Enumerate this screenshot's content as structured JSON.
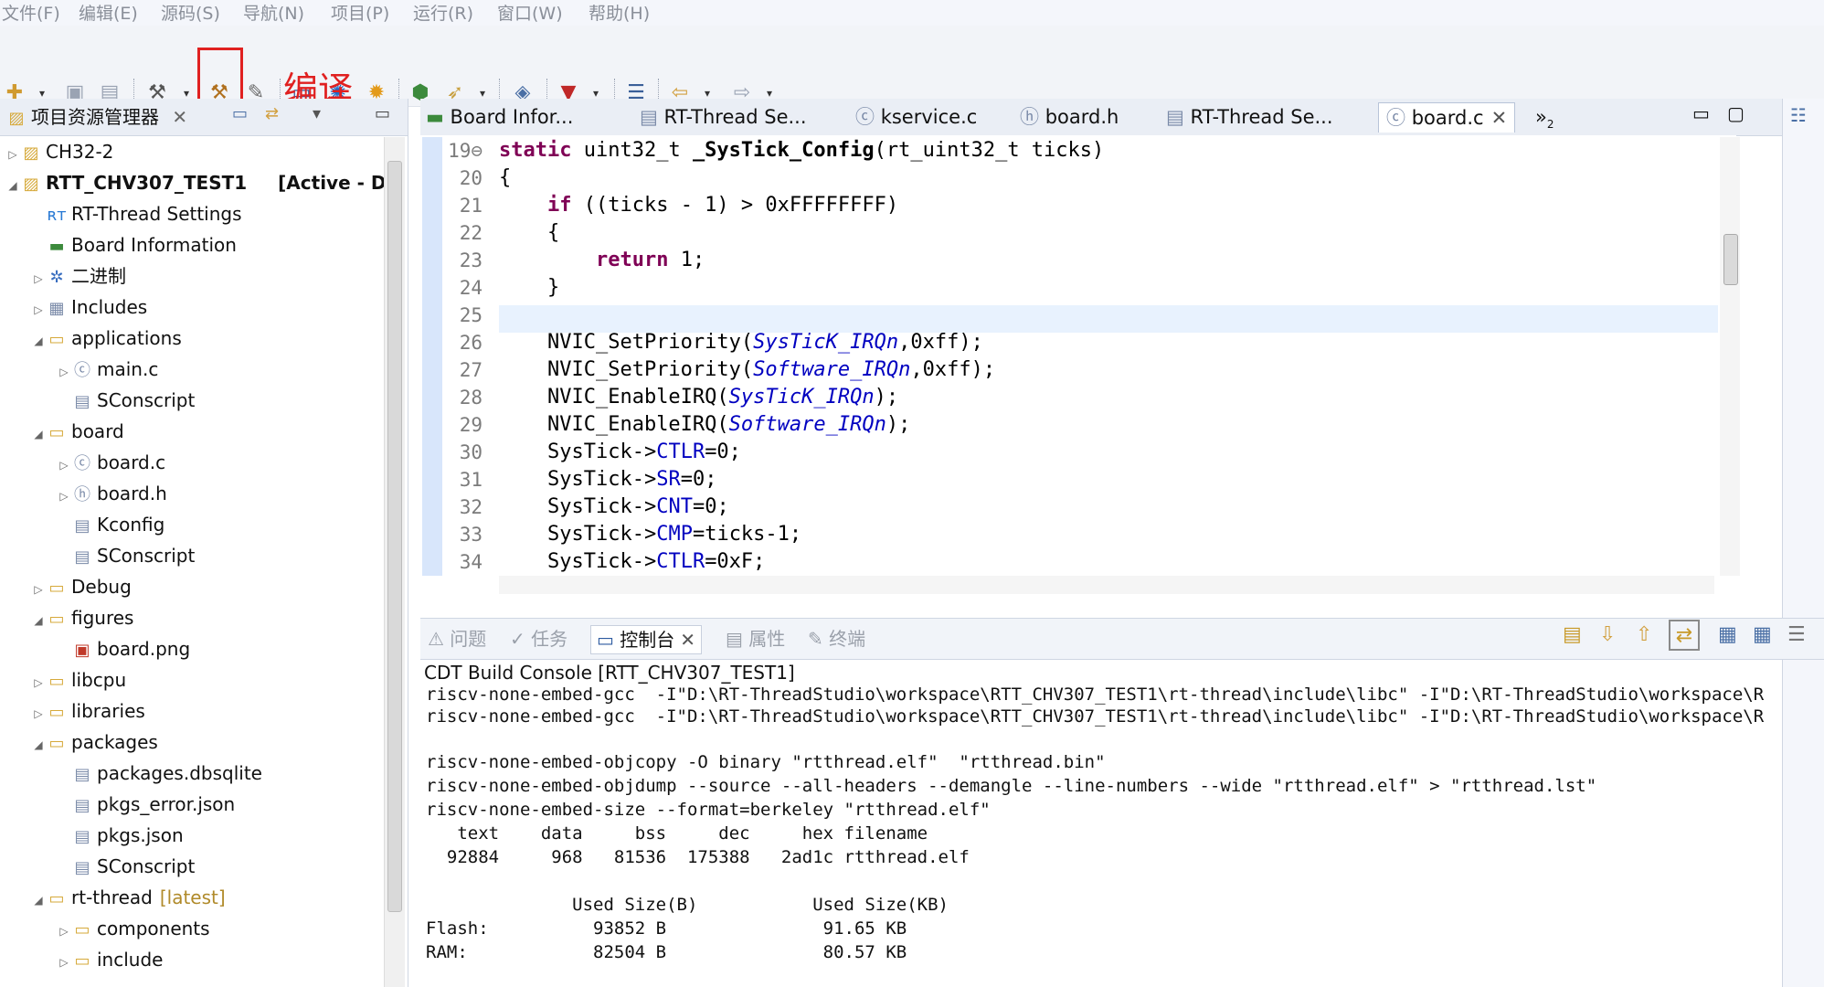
{
  "menu": [
    "文件(F)",
    "编辑(E)",
    "源码(S)",
    "导航(N)",
    "项目(P)",
    "运行(R)",
    "窗口(W)",
    "帮助(H)"
  ],
  "annotation": "编译",
  "explorer": {
    "title": "项目资源管理器",
    "items": [
      {
        "label": "CH32-2"
      },
      {
        "label": "RTT_CHV307_TEST1",
        "suffix": "[Active - De"
      },
      {
        "label": "RT-Thread Settings"
      },
      {
        "label": "Board Information"
      },
      {
        "label": "二进制"
      },
      {
        "label": "Includes"
      },
      {
        "label": "applications"
      },
      {
        "label": "main.c"
      },
      {
        "label": "SConscript"
      },
      {
        "label": "board"
      },
      {
        "label": "board.c"
      },
      {
        "label": "board.h"
      },
      {
        "label": "Kconfig"
      },
      {
        "label": "SConscript"
      },
      {
        "label": "Debug"
      },
      {
        "label": "figures"
      },
      {
        "label": "board.png"
      },
      {
        "label": "libcpu"
      },
      {
        "label": "libraries"
      },
      {
        "label": "packages"
      },
      {
        "label": "packages.dbsqlite"
      },
      {
        "label": "pkgs_error.json"
      },
      {
        "label": "pkgs.json"
      },
      {
        "label": "SConscript"
      },
      {
        "label": "rt-thread",
        "suffix": "[latest]"
      },
      {
        "label": "components"
      },
      {
        "label": "include"
      }
    ]
  },
  "editor": {
    "tabs": [
      "Board Infor...",
      "RT-Thread Se...",
      "kservice.c",
      "board.h",
      "RT-Thread Se...",
      "board.c"
    ],
    "overflow": "»",
    "overflow_count": "2",
    "lines": [
      {
        "n": "19⊖",
        "t": ""
      },
      {
        "n": "20",
        "t": "{"
      },
      {
        "n": "21",
        "t": ""
      },
      {
        "n": "22",
        "t": "    {"
      },
      {
        "n": "23",
        "t": ""
      },
      {
        "n": "24",
        "t": "    }"
      },
      {
        "n": "25",
        "t": ""
      },
      {
        "n": "26",
        "t": ""
      },
      {
        "n": "27",
        "t": ""
      },
      {
        "n": "28",
        "t": ""
      },
      {
        "n": "29",
        "t": ""
      },
      {
        "n": "30",
        "t": ""
      },
      {
        "n": "31",
        "t": ""
      },
      {
        "n": "32",
        "t": ""
      },
      {
        "n": "33",
        "t": ""
      },
      {
        "n": "34",
        "t": ""
      }
    ],
    "code": {
      "l19_kw": "static",
      "l19_rest": " uint32_t ",
      "l19_fn": "_SysTick_Config",
      "l19_args": "(rt_uint32_t ticks)",
      "l21_kw": "if",
      "l21_rest": " ((ticks - 1) > 0xFFFFFFFF)",
      "l23_kw": "return",
      "l23_rest": " 1;",
      "l26_a": "NVIC_SetPriority(",
      "l26_b": "SysTicK_IRQn",
      "l26_c": ",0xff);",
      "l27_a": "NVIC_SetPriority(",
      "l27_b": "Software_IRQn",
      "l27_c": ",0xff);",
      "l28_a": "NVIC_EnableIRQ(",
      "l28_b": "SysTicK_IRQn",
      "l28_c": ");",
      "l29_a": "NVIC_EnableIRQ(",
      "l29_b": "Software_IRQn",
      "l29_c": ");",
      "l30_a": "SysTick->",
      "l30_b": "CTLR",
      "l30_c": "=0;",
      "l31_a": "SysTick->",
      "l31_b": "SR",
      "l31_c": "=0;",
      "l32_a": "SysTick->",
      "l32_b": "CNT",
      "l32_c": "=0;",
      "l33_a": "SysTick->",
      "l33_b": "CMP",
      "l33_c": "=ticks-1;",
      "l34_a": "SysTick->",
      "l34_b": "CTLR",
      "l34_c": "=0xF;"
    }
  },
  "console": {
    "tabs": [
      "问题",
      "任务",
      "控制台",
      "属性",
      "终端"
    ],
    "title": "CDT Build Console [RTT_CHV307_TEST1]",
    "lines": [
      "riscv-none-embed-gcc  -I\"D:\\RT-ThreadStudio\\workspace\\RTT_CHV307_TEST1\\rt-thread\\include\\libc\" -I\"D:\\RT-ThreadStudio\\workspace\\R",
      "riscv-none-embed-gcc  -I\"D:\\RT-ThreadStudio\\workspace\\RTT_CHV307_TEST1\\rt-thread\\include\\libc\" -I\"D:\\RT-ThreadStudio\\workspace\\R",
      "",
      "riscv-none-embed-objcopy -O binary \"rtthread.elf\"  \"rtthread.bin\"",
      "riscv-none-embed-objdump --source --all-headers --demangle --line-numbers --wide \"rtthread.elf\" > \"rtthread.lst\"",
      "riscv-none-embed-size --format=berkeley \"rtthread.elf\"",
      "   text    data     bss     dec     hex filename",
      "  92884     968   81536  175388   2ad1c rtthread.elf",
      "",
      "              Used Size(B)           Used Size(KB)",
      "Flash:          93852 B               91.65 KB",
      "RAM:            82504 B               80.57 KB"
    ]
  },
  "colors": {
    "highlight": "#e02020",
    "keyword": "#7f0055",
    "field": "#0000c0"
  }
}
